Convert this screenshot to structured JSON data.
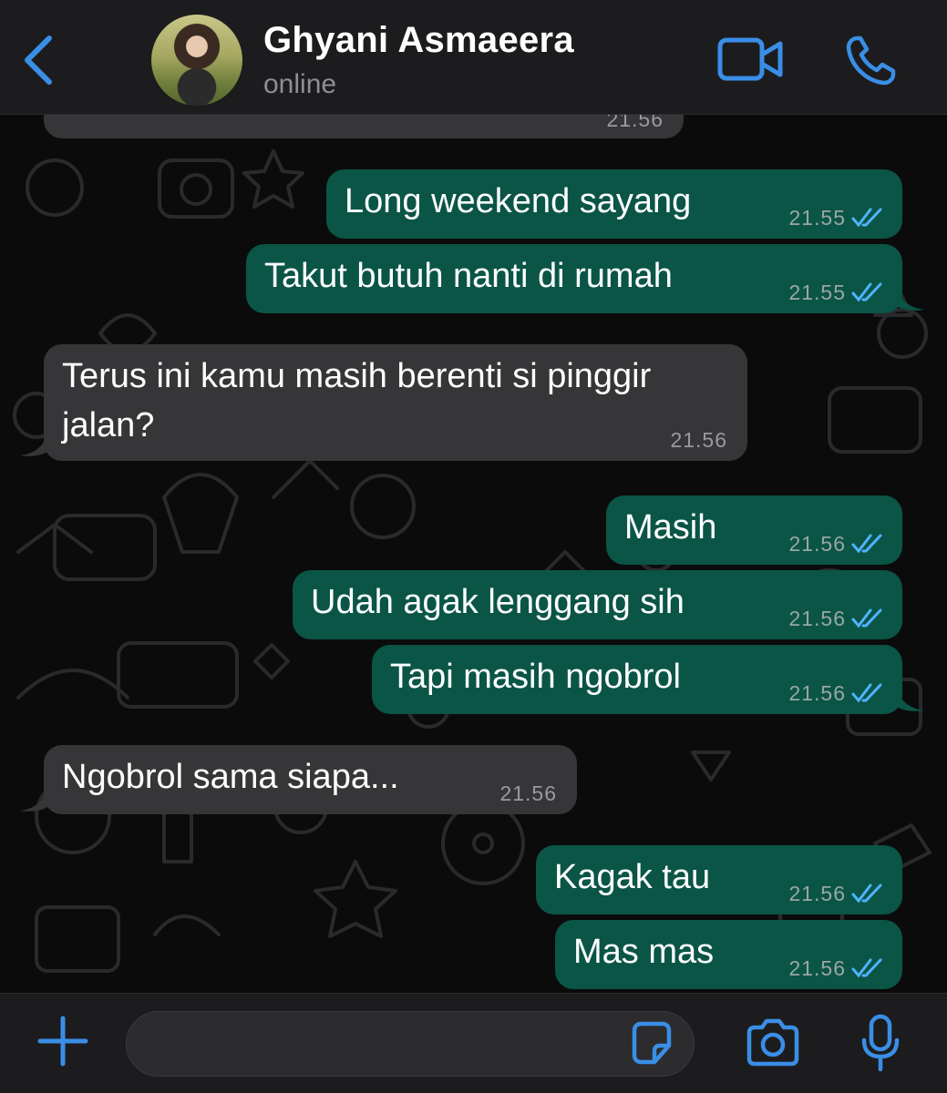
{
  "header": {
    "contact_name": "Ghyani Asmaeera",
    "status": "online",
    "icons": [
      "chevron-left-icon",
      "video-camera-icon",
      "phone-icon"
    ]
  },
  "chat": {
    "partial_message_time": "21.56",
    "messages": [
      {
        "direction": "out",
        "text": "Long weekend sayang",
        "time": "21.55",
        "read": true
      },
      {
        "direction": "out",
        "text": "Takut butuh nanti di rumah",
        "time": "21.55",
        "read": true
      },
      {
        "direction": "in",
        "text": "Terus ini kamu masih berenti si pinggir jalan?",
        "time": "21.56"
      },
      {
        "direction": "out",
        "text": "Masih",
        "time": "21.56",
        "read": true
      },
      {
        "direction": "out",
        "text": "Udah agak lenggang sih",
        "time": "21.56",
        "read": true
      },
      {
        "direction": "out",
        "text": "Tapi masih ngobrol",
        "time": "21.56",
        "read": true
      },
      {
        "direction": "in",
        "text": "Ngobrol sama siapa...",
        "time": "21.56"
      },
      {
        "direction": "out",
        "text": "Kagak tau",
        "time": "21.56",
        "read": true
      },
      {
        "direction": "out",
        "text": "Mas mas",
        "time": "21.56",
        "read": true
      }
    ]
  },
  "input_bar": {
    "placeholder": "",
    "icons": [
      "plus-icon",
      "sticker-icon",
      "camera-icon",
      "microphone-icon"
    ]
  },
  "colors": {
    "accent": "#3a8ee6",
    "outgoing_bubble": "#0a5546",
    "incoming_bubble": "#363638",
    "read_tick": "#4fb3ff"
  }
}
